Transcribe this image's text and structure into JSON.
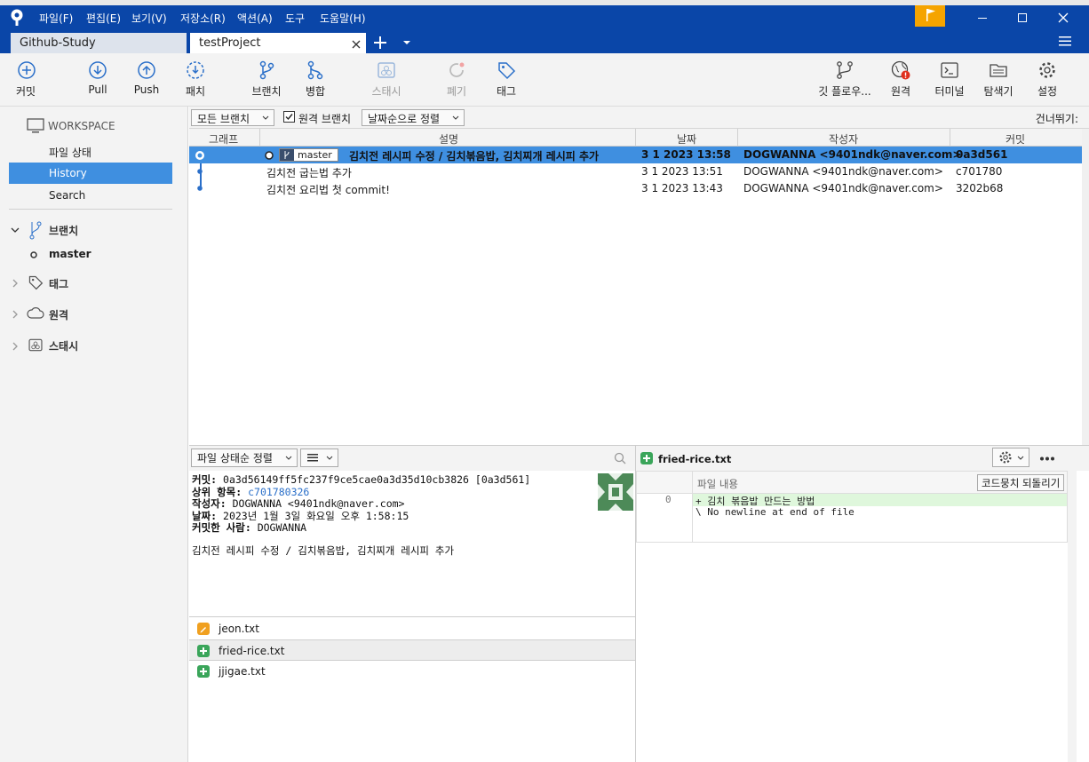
{
  "menu": [
    "파일(F)",
    "편집(E)",
    "보기(V)",
    "저장소(R)",
    "액션(A)",
    "도구",
    "도움말(H)"
  ],
  "tabs": [
    {
      "label": "Github-Study"
    },
    {
      "label": "testProject"
    }
  ],
  "toolbar": {
    "commit": "커밋",
    "pull": "Pull",
    "push": "Push",
    "patch": "패치",
    "branch": "브랜치",
    "merge": "병합",
    "stash": "스태시",
    "discard": "폐기",
    "tag": "태그",
    "gitflow": "깃 플로우...",
    "remote": "원격",
    "terminal": "터미널",
    "explorer": "탐색기",
    "settings": "설정"
  },
  "sidebar": {
    "workspace": "WORKSPACE",
    "file_status": "파일 상태",
    "history": "History",
    "search": "Search",
    "branches": "브랜치",
    "master": "master",
    "tags": "태그",
    "remotes": "원격",
    "stashes": "스태시"
  },
  "filter": {
    "branches": "모든 브랜치",
    "remote_branches": "원격 브랜치",
    "sort": "날짜순으로 정렬",
    "jump": "건너뛰기:"
  },
  "history_headers": {
    "graph": "그래프",
    "description": "설명",
    "date": "날짜",
    "author": "작성자",
    "commit": "커밋"
  },
  "commits": [
    {
      "branch": "master",
      "message": "김치전 레시피 수정 / 김치볶음밥, 김치찌개 레시피 추가",
      "date": "3 1 2023 13:58",
      "author": "DOGWANNA <9401ndk@naver.com>",
      "hash": "0a3d561"
    },
    {
      "message": "김치전 굽는법 추가",
      "date": "3 1 2023 13:51",
      "author": "DOGWANNA <9401ndk@naver.com>",
      "hash": "c701780"
    },
    {
      "message": "김치전 요리법 첫 commit!",
      "date": "3 1 2023 13:43",
      "author": "DOGWANNA <9401ndk@naver.com>",
      "hash": "3202b68"
    }
  ],
  "details": {
    "sort": "파일 상태순 정렬",
    "commit_label": "커밋:",
    "commit_value": "0a3d56149ff5fc237f9ce5cae0a3d35d10cb3826 [0a3d561]",
    "parent_label": "상위 항목:",
    "parent_value": "c701780326",
    "author_label": "작성자:",
    "author_value": "DOGWANNA <9401ndk@naver.com>",
    "date_label": "날짜:",
    "date_value": "2023년 1월 3일 화요일 오후 1:58:15",
    "committer_label": "커밋한 사람:",
    "committer_value": "DOGWANNA",
    "message": "김치전 레시피 수정 / 김치볶음밥, 김치찌개 레시피 추가"
  },
  "files": [
    {
      "name": "jeon.txt",
      "status": "modified",
      "color": "#f0a020"
    },
    {
      "name": "fried-rice.txt",
      "status": "added",
      "color": "#3aa55a"
    },
    {
      "name": "jjigae.txt",
      "status": "added",
      "color": "#3aa55a"
    }
  ],
  "diff": {
    "filename": "fried-rice.txt",
    "header": "파일 내용",
    "revert": "코드뭉치 되돌리기",
    "line_no": "0",
    "lines": [
      "+ 김치 볶음밥 만드는 방법",
      "\\  No newline at end of file"
    ]
  },
  "colors": {
    "accent": "#3f8fe0",
    "titlebar": "#0a46a8",
    "flag": "#f5a400"
  }
}
